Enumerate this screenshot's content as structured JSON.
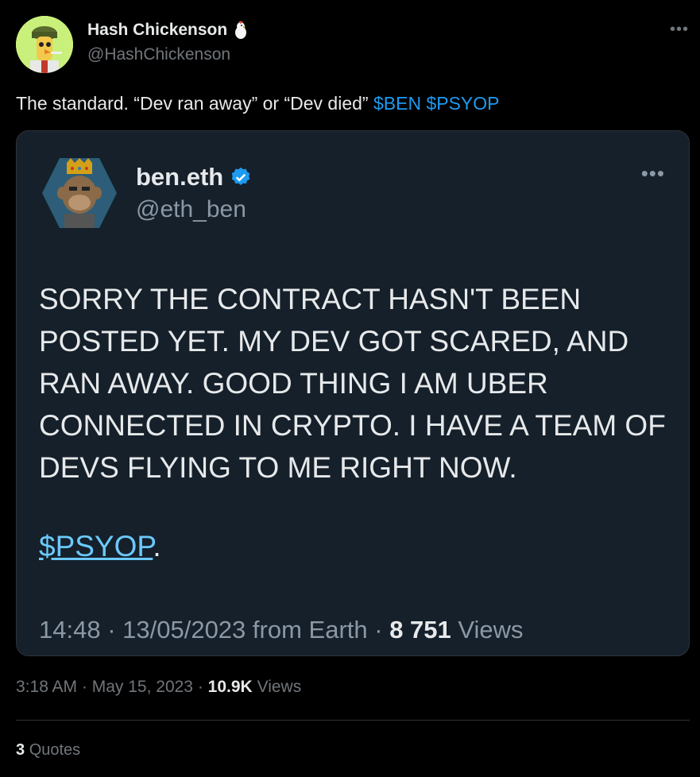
{
  "post": {
    "author_name": "Hash Chickenson",
    "author_handle": "@HashChickenson",
    "text_prefix": "The standard. “Dev ran away” or “Dev died” ",
    "cashtag_1": "$BEN",
    "cashtag_2": "$PSYOP",
    "time": "3:18 AM",
    "date": "May 15, 2023",
    "views_count": "10.9K",
    "views_label": "Views",
    "quotes_count": "3",
    "quotes_label": "Quotes",
    "more_icon": "more-horizontal-icon",
    "author_badge_icon": "chicken-icon"
  },
  "quoted": {
    "author_name": "ben.eth",
    "author_handle": "@eth_ben",
    "verified_icon": "verified-badge-icon",
    "lines": [
      "SORRY THE CONTRACT HASN'T BEEN",
      "POSTED YET. MY DEV GOT SCARED, AND",
      "RAN AWAY. GOOD THING I AM UBER",
      "CONNECTED IN CRYPTO. I HAVE A TEAM OF",
      "DEVS FLYING TO ME RIGHT NOW."
    ],
    "cashtag": "$PSYOP",
    "cashtag_suffix": ".",
    "time": "14:48",
    "date": "13/05/2023",
    "source": "from Earth",
    "views_count": "8 751",
    "views_label": "Views"
  },
  "colors": {
    "background": "#000000",
    "link": "#1d9bf0",
    "quote_card": "#15202b",
    "muted": "#71767b"
  }
}
